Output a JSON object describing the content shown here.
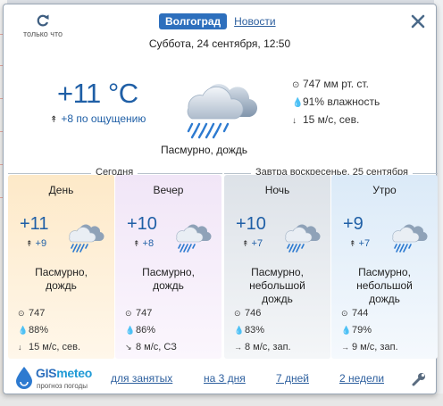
{
  "header": {
    "refresh_label": "только что",
    "city": "Волгоград",
    "news_link": "Новости",
    "date": "Суббота, 24 сентября, 12:50"
  },
  "current": {
    "temperature": "+11 °C",
    "feels_like": "+8 по ощущению",
    "condition": "Пасмурно, дождь",
    "pressure": "747 мм рт. ст.",
    "humidity": "91% влажность",
    "wind": "15 м/с, сев."
  },
  "sections": {
    "today": "Сегодня",
    "tomorrow": "Завтра воскресенье, 25 сентября"
  },
  "forecast": [
    {
      "label": "День",
      "temp": "+11",
      "feels": "+9",
      "condition": "Пасмурно, дождь",
      "pressure": "747",
      "humidity": "88%",
      "wind": "15 м/с, сев.",
      "wind_icon": "↓"
    },
    {
      "label": "Вечер",
      "temp": "+10",
      "feels": "+8",
      "condition": "Пасмурно, дождь",
      "pressure": "747",
      "humidity": "86%",
      "wind": "8 м/с, СЗ",
      "wind_icon": "↘"
    },
    {
      "label": "Ночь",
      "temp": "+10",
      "feels": "+7",
      "condition": "Пасмурно, небольшой дождь",
      "pressure": "746",
      "humidity": "83%",
      "wind": "8 м/с, зап.",
      "wind_icon": "→"
    },
    {
      "label": "Утро",
      "temp": "+9",
      "feels": "+7",
      "condition": "Пасмурно, небольшой дождь",
      "pressure": "744",
      "humidity": "79%",
      "wind": "9 м/с, зап.",
      "wind_icon": "→"
    }
  ],
  "footer": {
    "logo_brand": "meteo",
    "logo_prefix": "GIS",
    "logo_tagline": "прогноз погоды",
    "links": [
      "для занятых",
      "на 3 дня",
      "7 дней",
      "2 недели"
    ]
  },
  "icons": {
    "refresh": "refresh-icon",
    "close": "close-icon",
    "settings": "wrench-icon",
    "weather": "cloud-rain-icon"
  },
  "colors": {
    "accent": "#2d6fbd",
    "temperature": "#1f5fa6"
  }
}
